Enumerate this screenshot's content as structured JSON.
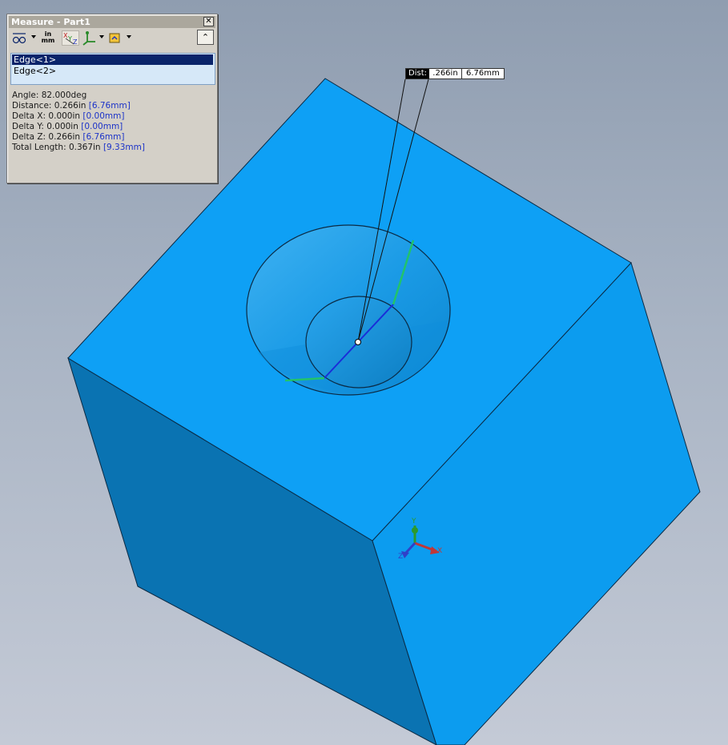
{
  "window": {
    "title": "Measure - Part1",
    "close_glyph": "✕"
  },
  "toolbar": {
    "items": [
      "arc-circle-measurements-icon",
      "units-precision-icon",
      "xyz-measurements-icon",
      "point-to-point-icon",
      "create-sensor-icon"
    ],
    "units_top": "in",
    "units_bottom": "mm",
    "expand_glyph": "⌃"
  },
  "selection": {
    "items": [
      {
        "label": "Edge<1>",
        "selected": true
      },
      {
        "label": "Edge<2>",
        "selected": false
      }
    ]
  },
  "results": {
    "angle": "Angle: 82.000deg",
    "distance": {
      "label": "Distance: 0.266in",
      "mm": "[6.76mm]"
    },
    "delta_x": {
      "label": "Delta X: 0.000in",
      "mm": "[0.00mm]"
    },
    "delta_y": {
      "label": "Delta Y: 0.000in",
      "mm": "[0.00mm]"
    },
    "delta_z": {
      "label": "Delta Z: 0.266in",
      "mm": "[6.76mm]"
    },
    "total_length": {
      "label": "Total Length: 0.367in",
      "mm": "[9.33mm]"
    }
  },
  "callout": {
    "label": "Dist:",
    "value_in": ".266in",
    "value_mm": "6.76mm"
  },
  "triad": {
    "x": "X",
    "y": "Y",
    "z": "Z"
  },
  "colors": {
    "background_top": "#8f9db0",
    "part_face": "#0ea0f5",
    "part_side_left": "#0a73b2",
    "part_side_right": "#0b9bee",
    "selected_edge_blue": "#1a2ed8",
    "selected_edge_green": "#22c46a",
    "mm_text": "#1c33c8",
    "selection_highlight": "#0a246a"
  }
}
